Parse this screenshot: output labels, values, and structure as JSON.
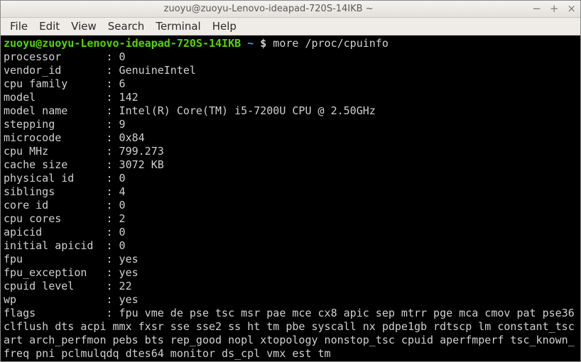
{
  "window": {
    "title": "zuoyu@zuoyu-Lenovo-ideapad-720S-14IKB ~",
    "controls": {
      "minimize": "−",
      "maximize": "+",
      "close": "×"
    }
  },
  "menubar": {
    "file": "File",
    "edit": "Edit",
    "view": "View",
    "search": "Search",
    "terminal": "Terminal",
    "help": "Help"
  },
  "prompt": {
    "userhost": "zuoyu@zuoyu-Lenovo-ideapad-720S-14IKB",
    "path": "~",
    "symbol": "$",
    "command": "more /proc/cpuinfo"
  },
  "cpuinfo": {
    "fields": [
      {
        "key": "processor",
        "val": "0"
      },
      {
        "key": "vendor_id",
        "val": "GenuineIntel"
      },
      {
        "key": "cpu family",
        "val": "6"
      },
      {
        "key": "model",
        "val": "142"
      },
      {
        "key": "model name",
        "val": "Intel(R) Core(TM) i5-7200U CPU @ 2.50GHz"
      },
      {
        "key": "stepping",
        "val": "9"
      },
      {
        "key": "microcode",
        "val": "0x84"
      },
      {
        "key": "cpu MHz",
        "val": "799.273"
      },
      {
        "key": "cache size",
        "val": "3072 KB"
      },
      {
        "key": "physical id",
        "val": "0"
      },
      {
        "key": "siblings",
        "val": "4"
      },
      {
        "key": "core id",
        "val": "0"
      },
      {
        "key": "cpu cores",
        "val": "2"
      },
      {
        "key": "apicid",
        "val": "0"
      },
      {
        "key": "initial apicid",
        "val": "0"
      },
      {
        "key": "fpu",
        "val": "yes"
      },
      {
        "key": "fpu_exception",
        "val": "yes"
      },
      {
        "key": "cpuid level",
        "val": "22"
      },
      {
        "key": "wp",
        "val": "yes"
      }
    ],
    "flags_key": "flags",
    "flags_value": "fpu vme de pse tsc msr pae mce cx8 apic sep mtrr pge mca cmov pat pse36 clflush dts acpi mmx fxsr sse sse2 ss ht tm pbe syscall nx pdpe1gb rdtscp lm constant_tsc art arch_perfmon pebs bts rep_good nopl xtopology nonstop_tsc cpuid aperfmperf tsc_known_freq pni pclmulqdq dtes64 monitor ds_cpl vmx est tm"
  }
}
